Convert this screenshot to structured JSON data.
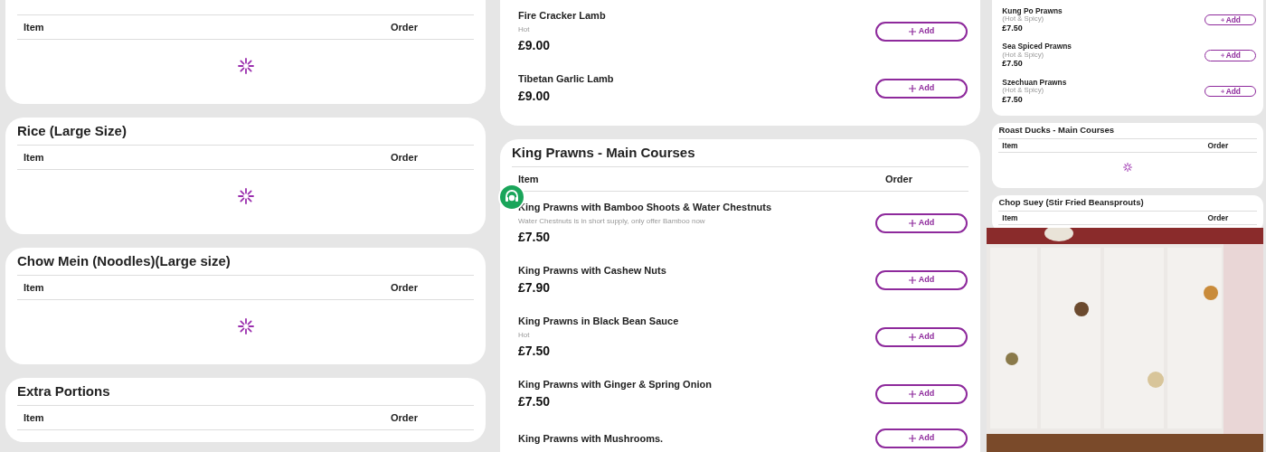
{
  "columns": [
    {
      "sections": [
        {
          "header": [
            "Item",
            "Order"
          ],
          "loading": true
        },
        {
          "title": "Rice (Large Size)",
          "header": [
            "Item",
            "Order"
          ],
          "loading": true
        },
        {
          "title": "Chow Mein (Noodles)(Large size)",
          "header": [
            "Item",
            "Order"
          ],
          "loading": true
        },
        {
          "title": "Extra Portions",
          "header": [
            "Item",
            "Order"
          ],
          "loading": false
        }
      ]
    },
    {
      "sections": [
        {
          "loading": false,
          "items": [
            {
              "name": "Fire Cracker Lamb",
              "note": "Hot",
              "price": "£9.00",
              "button": "Add"
            },
            {
              "name": "Tibetan Garlic Lamb",
              "price": "£9.00",
              "button": "Add"
            }
          ]
        },
        {
          "title": "King Prawns - Main Courses",
          "header": [
            "Item",
            "Order"
          ],
          "loading": false,
          "items": [
            {
              "name": "King Prawns with Bamboo Shoots & Water Chestnuts",
              "note": "Water Chestnuts is in short supply, only offer Bamboo now",
              "price": "£7.50",
              "button": "Add"
            },
            {
              "name": "King Prawns with Cashew Nuts",
              "price": "£7.90",
              "button": "Add"
            },
            {
              "name": "King Prawns in Black Bean Sauce",
              "note": "Hot",
              "price": "£7.50",
              "button": "Add"
            },
            {
              "name": "King Prawns with Ginger & Spring Onion",
              "price": "£7.50",
              "button": "Add"
            },
            {
              "name": "King Prawns with Mushrooms.",
              "button": "Add"
            }
          ]
        }
      ]
    },
    {
      "sections": [
        {
          "loading": false,
          "items": [
            {
              "name": "Kung Po Prawns",
              "note": "(Hot & Spicy)",
              "price": "£7.50",
              "button": "Add"
            },
            {
              "name": "Sea Spiced Prawns",
              "note": "(Hot & Spicy)",
              "price": "£7.50",
              "button": "Add"
            },
            {
              "name": "Szechuan Prawns",
              "note": "(Hot & Spicy)",
              "price": "£7.50",
              "button": "Add"
            }
          ]
        },
        {
          "title": "Roast Ducks - Main Courses",
          "header": [
            "Item",
            "Order"
          ],
          "loading": true
        },
        {
          "title": "Chop Suey (Stir Fried Beansprouts)",
          "header": [
            "Item",
            "Order"
          ],
          "loading": false
        }
      ],
      "photo": {
        "kind": "picture"
      }
    }
  ],
  "chat_button": {
    "kind": "chat"
  }
}
